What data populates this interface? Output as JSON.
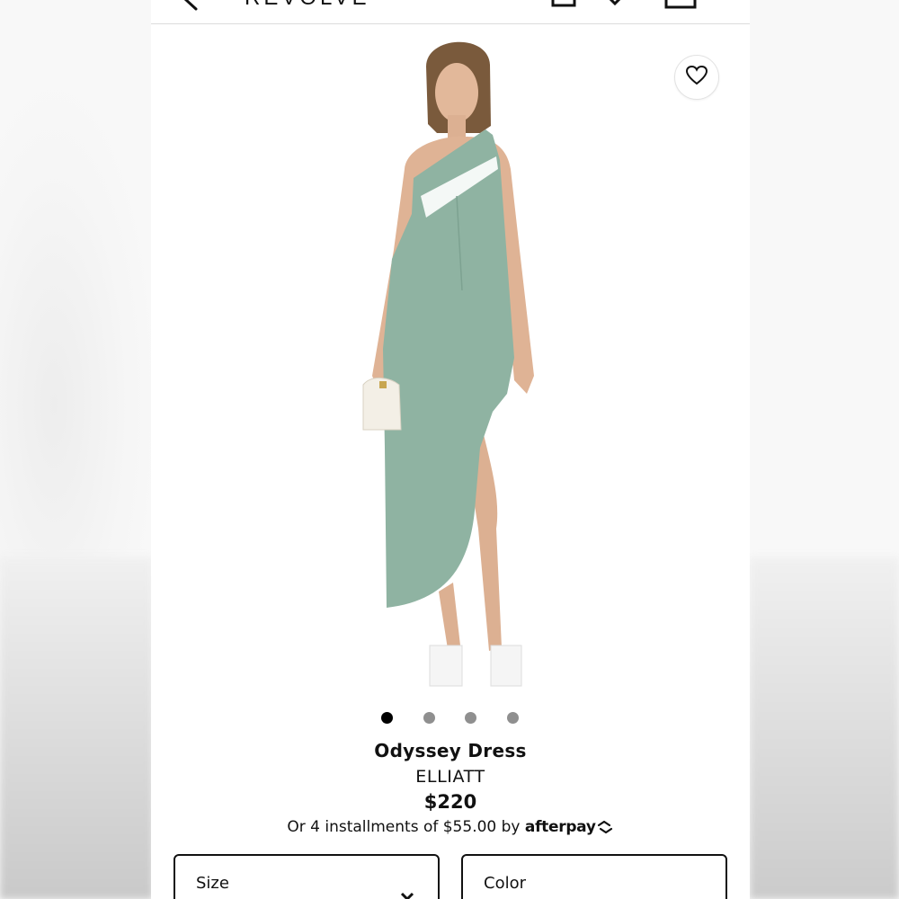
{
  "header": {
    "logo_text": "REVOLVE",
    "icons": [
      "back-icon",
      "bag-icon",
      "check-icon",
      "cart-icon"
    ]
  },
  "gallery": {
    "dot_count": 4,
    "active_dot": 1,
    "wishlist_icon": "heart-icon"
  },
  "product": {
    "name": "Odyssey Dress",
    "brand": "ELLIATT",
    "price": "$220",
    "installment_text": "Or 4 installments of $55.00 by",
    "afterpay_label": "afterpay"
  },
  "options": {
    "size_label": "Size",
    "color_label": "Color"
  },
  "colors": {
    "dress": "#8fb3a2",
    "accent": "#111111"
  }
}
